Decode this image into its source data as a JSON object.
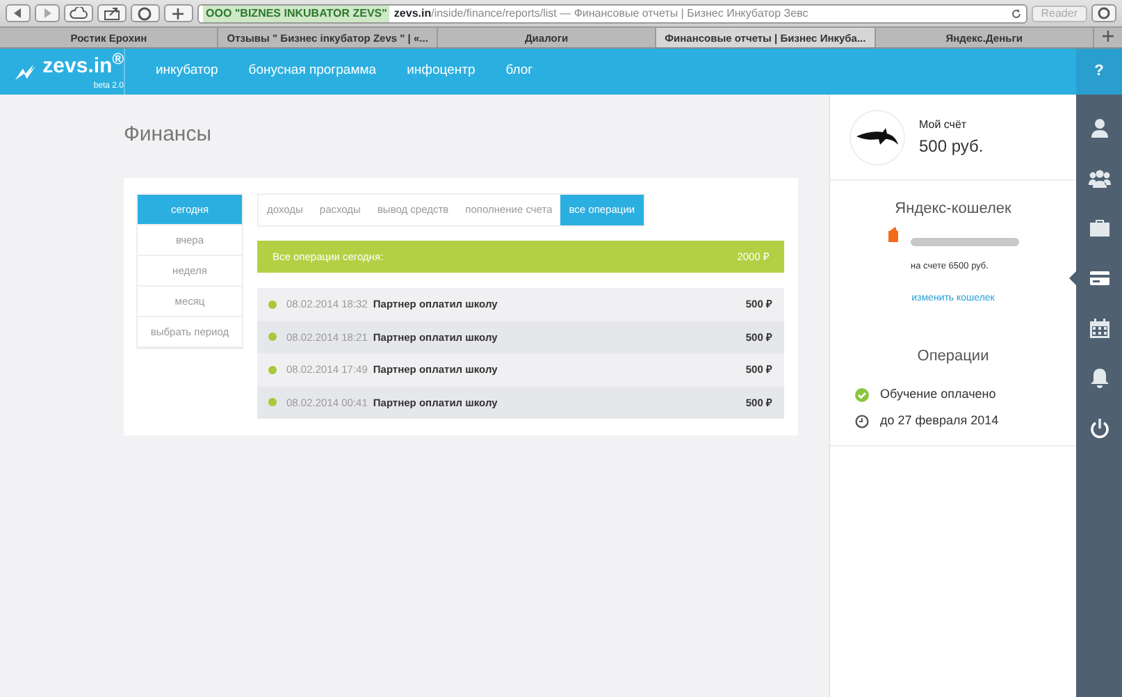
{
  "browser": {
    "secure_label": "ООО \"BIZNES INKUBATOR ZEVS\"",
    "url_host": "zevs.in",
    "url_path": "/inside/finance/reports/list",
    "url_title": " — Финансовые отчеты | Бизнес Инкубатор Зевс",
    "reader": "Reader",
    "tabs": [
      {
        "label": "Ростик Ерохин",
        "selected": false
      },
      {
        "label": "Отзывы \" Бизнес inкубатор Zevs \" | «...",
        "selected": false
      },
      {
        "label": "Диалоги",
        "selected": false
      },
      {
        "label": "Финансовые отчеты | Бизнес Инкуба...",
        "selected": true
      },
      {
        "label": "Яндекс.Деньги",
        "selected": false
      }
    ]
  },
  "app": {
    "logo": "zevs.in",
    "logo_mark": "®",
    "logo_sub": "beta 2.0",
    "nav": [
      "инкубатор",
      "бонусная программа",
      "инфоцентр",
      "блог"
    ],
    "help": "?"
  },
  "page": {
    "title": "Финансы",
    "periods": [
      {
        "label": "сегодня",
        "selected": true
      },
      {
        "label": "вчера",
        "selected": false
      },
      {
        "label": "неделя",
        "selected": false
      },
      {
        "label": "месяц",
        "selected": false
      },
      {
        "label": "выбрать период",
        "selected": false
      }
    ],
    "filters": [
      {
        "label": "доходы",
        "selected": false
      },
      {
        "label": "расходы",
        "selected": false
      },
      {
        "label": "вывод средств",
        "selected": false
      },
      {
        "label": "пополнение счета",
        "selected": false
      },
      {
        "label": "все операции",
        "selected": true
      }
    ],
    "summary": {
      "label": "Все операции сегодня:",
      "amount": "2000 ₽"
    },
    "operations": [
      {
        "time": "08.02.2014 18:32",
        "text": "Партнер оплатил школу",
        "amount": "500 ₽"
      },
      {
        "time": "08.02.2014 18:21",
        "text": "Партнер оплатил школу",
        "amount": "500 ₽"
      },
      {
        "time": "08.02.2014 17:49",
        "text": "Партнер оплатил школу",
        "amount": "500 ₽"
      },
      {
        "time": "08.02.2014 00:41",
        "text": "Партнер оплатил школу",
        "amount": "500 ₽"
      }
    ]
  },
  "account": {
    "label": "Мой счёт",
    "balance": "500 руб."
  },
  "wallet": {
    "title": "Яндекс-кошелек",
    "balance": "на счете 6500 руб.",
    "change_link": "изменить кошелек"
  },
  "status": {
    "title": "Операции",
    "items": [
      {
        "kind": "check",
        "text": "Обучение оплачено"
      },
      {
        "kind": "clock",
        "text": "до 27 февраля 2014"
      }
    ]
  },
  "rail": [
    {
      "kind": "user",
      "selected": false
    },
    {
      "kind": "group",
      "selected": false
    },
    {
      "kind": "briefcase",
      "selected": false
    },
    {
      "kind": "card",
      "selected": true
    },
    {
      "kind": "calendar",
      "selected": false
    },
    {
      "kind": "bell",
      "selected": false
    },
    {
      "kind": "power",
      "selected": false
    }
  ]
}
